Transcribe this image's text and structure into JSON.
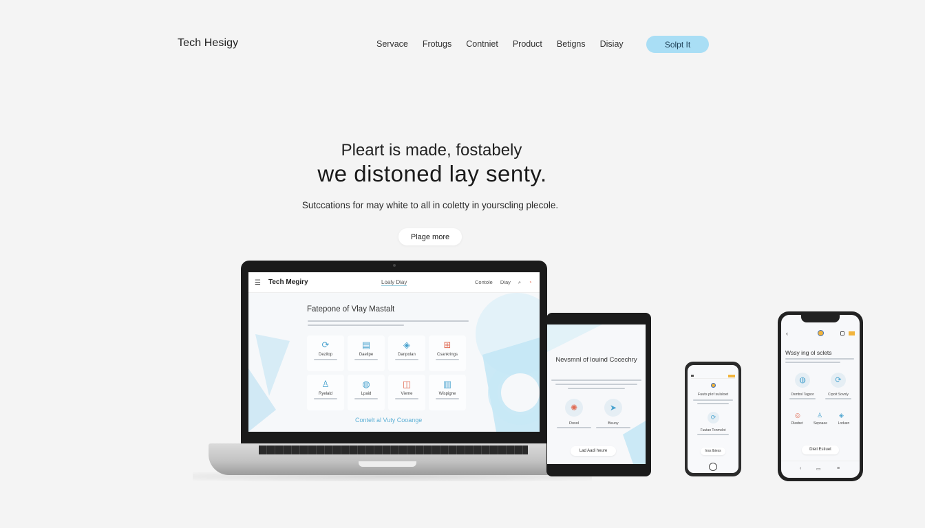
{
  "header": {
    "brand": "Tech Hesigy",
    "nav": [
      "Servace",
      "Frotugs",
      "Contniet",
      "Product",
      "Betigns",
      "Disiay"
    ],
    "cta_label": "Solpt It",
    "cta_color": "#a9def5"
  },
  "hero": {
    "line1": "Pleart is made, fostabely",
    "line2": "we distoned lay senty.",
    "subtitle": "Sutccations for may white to all in coletty in yourscling plecole.",
    "button_label": "Plage more"
  },
  "laptop": {
    "brand": "Tech Megiry",
    "menu_icon": "hamburger-icon",
    "center_link": "Loaly Diay",
    "right_links": [
      "Contole",
      "Diay"
    ],
    "heading": "Fatepone of Vlay Mastalt",
    "tiles": [
      {
        "icon": "refresh-icon",
        "label": "Dezilop"
      },
      {
        "icon": "document-icon",
        "label": "Daelipe"
      },
      {
        "icon": "layers-icon",
        "label": "Danpolan"
      },
      {
        "icon": "grid-icon",
        "label": "Csankrings"
      },
      {
        "icon": "user-icon",
        "label": "Ryelald"
      },
      {
        "icon": "globe-icon",
        "label": "Lpaid"
      },
      {
        "icon": "chat-icon",
        "label": "Vieme"
      },
      {
        "icon": "chart-icon",
        "label": "Wispigne"
      }
    ],
    "link": "Contelt al Vuty Cooange",
    "accent": "#5fb1d6"
  },
  "tablet": {
    "title": "Nevsmnl of louind Cocechry",
    "items": [
      {
        "icon": "compass-icon",
        "label": "Dosol"
      },
      {
        "icon": "send-icon",
        "label": "Bsuoy"
      }
    ],
    "button": "Lad Aadi heure"
  },
  "phone_small": {
    "title": "Fuuts plof sulsloet",
    "item_label": "Fuutan Tonmclot",
    "button": "Inss lbiess"
  },
  "phone_large": {
    "title": "Wssy ing ol sclets",
    "items": [
      "Dsmbol Tagsor",
      "Crpoit Sovnly"
    ],
    "small_items": [
      "Dlasbet",
      "Sepoaee",
      "Loduen"
    ],
    "button": "Dleil Estiuet"
  }
}
